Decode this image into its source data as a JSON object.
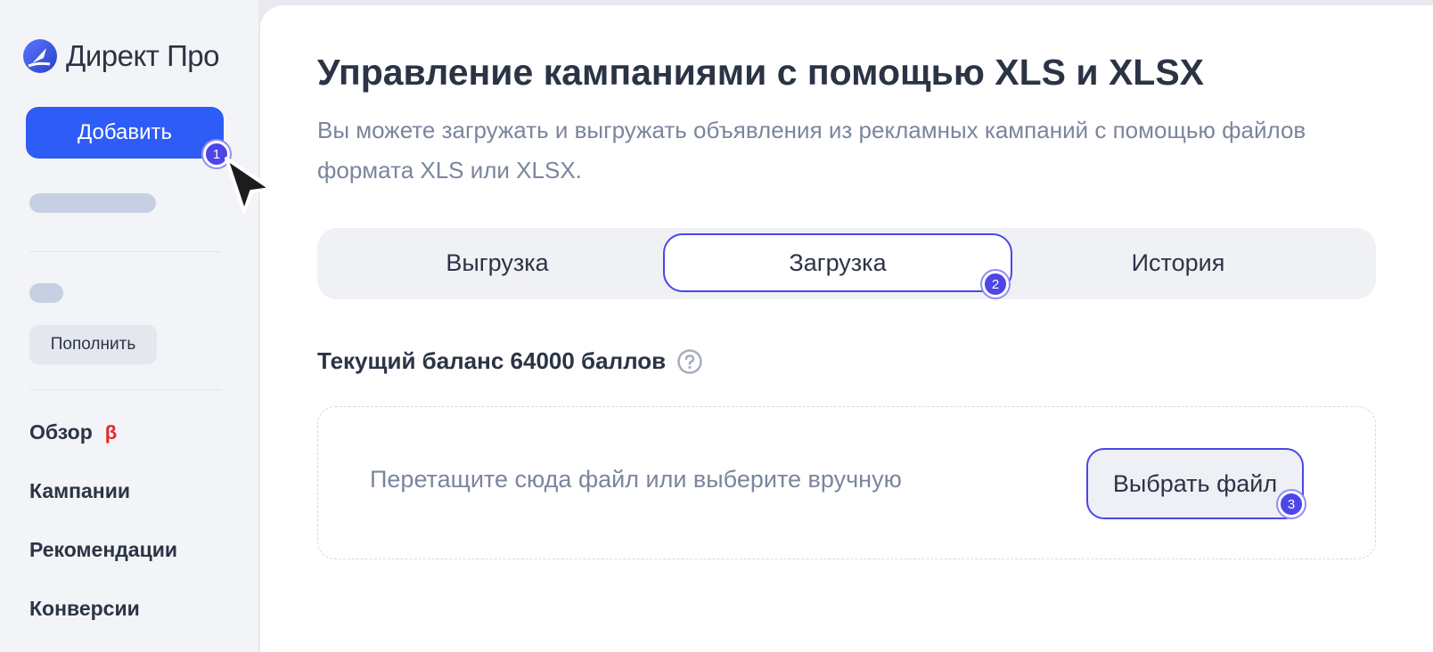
{
  "sidebar": {
    "logo_text": "Директ Про",
    "add_button": "Добавить",
    "topup_button": "Пополнить",
    "nav": [
      {
        "label": "Обзор",
        "badge": "β"
      },
      {
        "label": "Кампании"
      },
      {
        "label": "Рекомендации"
      },
      {
        "label": "Конверсии"
      }
    ]
  },
  "main": {
    "title": "Управление кампаниями с помощью XLS и XLSX",
    "description": "Вы можете загружать и выгружать объявления из рекламных кампаний с помощью файлов формата XLS или XLSX.",
    "tabs": [
      {
        "label": "Выгрузка",
        "active": false
      },
      {
        "label": "Загрузка",
        "active": true
      },
      {
        "label": "История",
        "active": false
      }
    ],
    "balance": "Текущий баланс 64000 баллов",
    "dropzone": {
      "hint": "Перетащите сюда файл или выберите вручную",
      "choose_button": "Выбрать файл"
    }
  },
  "markers": [
    "1",
    "2",
    "3"
  ],
  "icons": {
    "logo": "direct-logo-icon",
    "help": "question-circle-icon",
    "cursor": "mouse-pointer-icon"
  },
  "colors": {
    "primary": "#2e5cf6",
    "highlight": "#4c45e8",
    "beta": "#e42828"
  }
}
